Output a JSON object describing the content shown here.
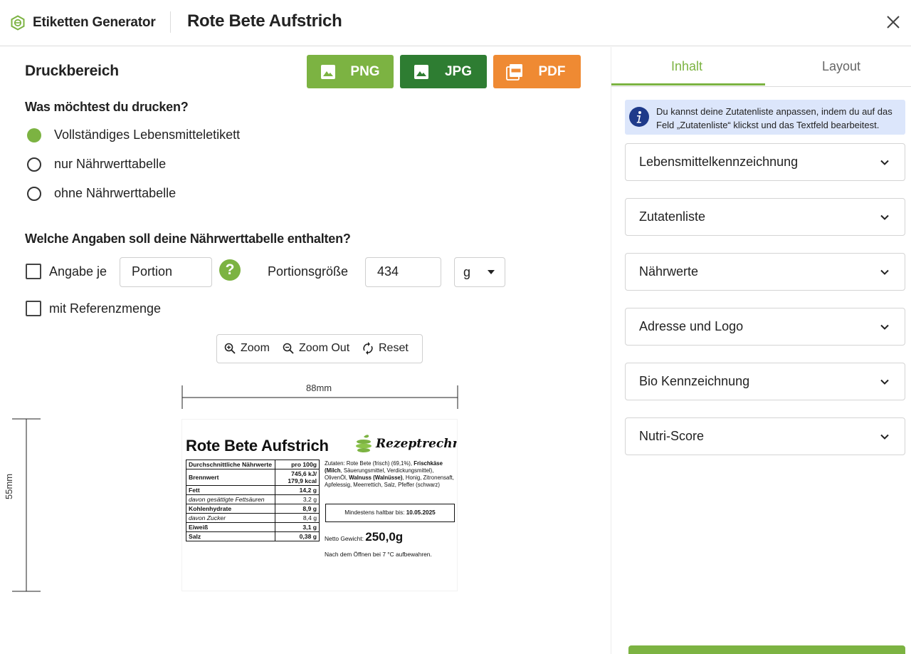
{
  "header": {
    "app_name": "Etiketten Generator",
    "page_title": "Rote Bete Aufstrich"
  },
  "print_area": {
    "title": "Druckbereich",
    "export_buttons": {
      "png": "PNG",
      "jpg": "JPG",
      "pdf": "PDF"
    },
    "question_print": "Was möchtest du drucken?",
    "print_options": [
      {
        "label": "Vollständiges Lebensmitteletikett",
        "selected": true
      },
      {
        "label": "nur Nährwerttabelle",
        "selected": false
      },
      {
        "label": "ohne Nährwerttabelle",
        "selected": false
      }
    ],
    "question_table": "Welche Angaben soll deine Nährwerttabelle enthalten?",
    "per_label": "Angabe je",
    "per_value": "Portion",
    "per_checked": false,
    "portion_size_label": "Portionsgröße",
    "portion_size_value": "434",
    "unit": "g",
    "reference_label": "mit Referenzmenge",
    "reference_checked": false,
    "zoom": {
      "zoom_in": "Zoom",
      "zoom_out": "Zoom Out",
      "reset": "Reset"
    },
    "width_label": "88mm",
    "height_label": "55mm"
  },
  "label_preview": {
    "title": "Rote Bete Aufstrich",
    "logo_text": "Rezeptrechner",
    "table_header_left": "Durchschnittliche Nährwerte",
    "table_header_right": "pro 100g",
    "rows": [
      {
        "name": "Brennwert",
        "value": "745,6 kJ/ 179,9 kcal",
        "style": "bold"
      },
      {
        "name": "Fett",
        "value": "14,2 g",
        "style": "bold"
      },
      {
        "name": "davon gesättigte Fettsäuren",
        "value": "3,2 g",
        "style": "italic"
      },
      {
        "name": "Kohlenhydrate",
        "value": "8,9 g",
        "style": "bold"
      },
      {
        "name": "davon Zucker",
        "value": "8,4 g",
        "style": "italic"
      },
      {
        "name": "Eiweiß",
        "value": "3,1 g",
        "style": "bold"
      },
      {
        "name": "Salz",
        "value": "0,38 g",
        "style": "bold"
      }
    ],
    "ingredients": {
      "prefix": "Zutaten: Rote Bete (frisch) (69,1%), ",
      "frischkaese": "Frischkäse (",
      "milch": "Milch",
      "after_milch": ", Säuerungsmittel, Verdickungsmittel), OlivenÖl, ",
      "walnuss": "Walnuss (Walnüsse)",
      "suffix": ", Honig, Zitronensaft, Apfelessig, Meerrettich, Salz, Pfeffer (schwarz)"
    },
    "best_before_label": "Mindestens haltbar bis: ",
    "best_before_date": "10.05.2025",
    "net_weight_label": "Netto Gewicht: ",
    "net_weight_value": "250,0g",
    "storage_note": "Nach dem Öffnen bei 7 °C aufbewahren."
  },
  "sidebar": {
    "tabs": [
      {
        "label": "Inhalt",
        "active": true
      },
      {
        "label": "Layout",
        "active": false
      }
    ],
    "info_text": "Du kannst deine Zutatenliste anpassen, indem du auf das Feld „Zutatenliste“ klickst und das Textfeld bearbeitest.",
    "sections": [
      {
        "label": "Lebensmittelkennzeichnung"
      },
      {
        "label": "Zutatenliste"
      },
      {
        "label": "Nährwerte"
      },
      {
        "label": "Adresse und Logo"
      },
      {
        "label": "Bio Kennzeichnung"
      },
      {
        "label": "Nutri-Score"
      }
    ]
  },
  "colors": {
    "accent_green": "#7cb342",
    "dark_green": "#2e7d32",
    "orange": "#ef8a33",
    "info_bg": "#dce6fb",
    "info_icon": "#1e3a8a"
  },
  "icons": {
    "brand": "hexagon-logo-icon",
    "close": "close-icon",
    "png": "image-icon",
    "jpg": "image-icon",
    "pdf": "pdf-icon",
    "help": "question-icon",
    "info": "info-icon",
    "chevron": "chevron-down-icon"
  }
}
